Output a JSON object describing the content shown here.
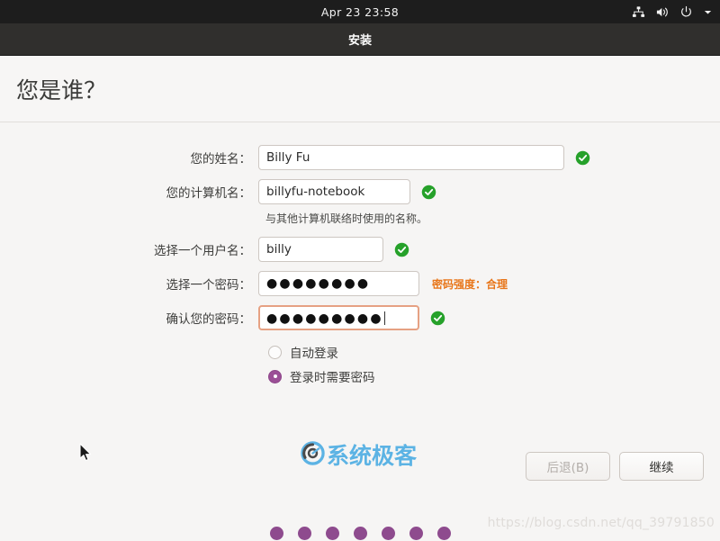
{
  "topbar": {
    "clock": "Apr 23  23:58",
    "indicators": [
      {
        "name": "network-icon"
      },
      {
        "name": "volume-icon"
      },
      {
        "name": "power-icon"
      },
      {
        "name": "chevron-down-icon"
      }
    ]
  },
  "window": {
    "title": "安装"
  },
  "page": {
    "title": "您是谁？"
  },
  "form": {
    "fields": [
      {
        "label": "您的姓名：",
        "value": "Billy Fu",
        "placeholder": "",
        "valid": true
      },
      {
        "label": "您的计算机名：",
        "value": "billyfu-notebook",
        "placeholder": "",
        "valid": true,
        "hint": "与其他计算机联络时使用的名称。"
      },
      {
        "label": "选择一个用户名：",
        "value": "billy",
        "placeholder": "",
        "valid": true
      },
      {
        "label": "选择一个密码：",
        "value": "●●●●●●●●",
        "placeholder": "",
        "valid": false,
        "strength": "密码强度：合理",
        "strength_color": "#e8761a"
      },
      {
        "label": "确认您的密码：",
        "value": "●●●●●●●●●",
        "placeholder": "",
        "valid": true,
        "focused": true
      }
    ]
  },
  "login_options": [
    {
      "label": "自动登录",
      "selected": false
    },
    {
      "label": "登录时需要密码",
      "selected": true
    }
  ],
  "watermark": {
    "text": "系统极客",
    "color": "#5cb3e4"
  },
  "buttons": {
    "back": "后退(B)",
    "back_disabled": true,
    "continue": "继续"
  },
  "progress": {
    "dot_count": 7,
    "dot_color": "#8e4b8e"
  },
  "url_watermark": "https://blog.csdn.net/qq_39791850",
  "colors": {
    "topbar_bg": "#1d1d1d",
    "titlebar_bg": "#302f2d",
    "page_bg": "#f6f5f4",
    "accent_purple": "#9b4f96",
    "valid_green": "#26a12a",
    "focus_border": "#e6a183"
  }
}
